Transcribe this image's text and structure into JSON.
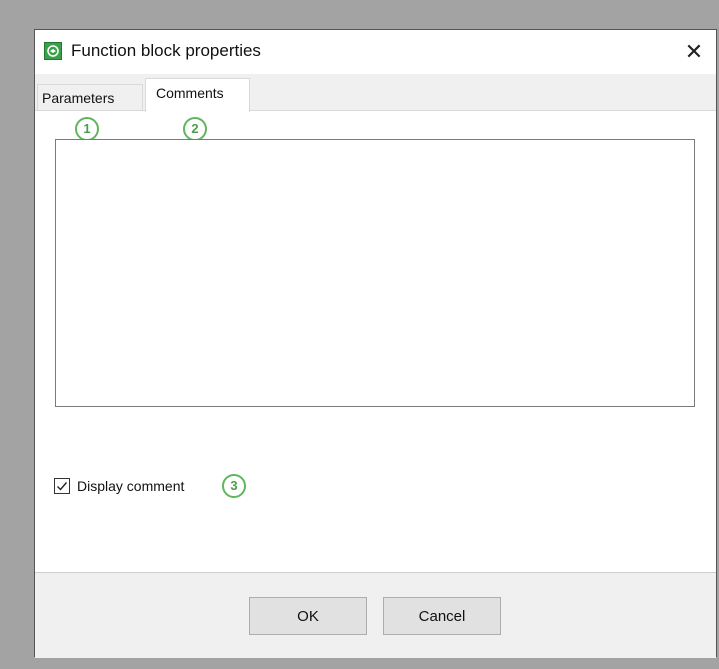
{
  "window": {
    "title": "Function block properties",
    "close_glyph": "✕",
    "app_icon": "function-block-icon"
  },
  "tabs": [
    {
      "label": "Parameters",
      "selected": false
    },
    {
      "label": "Comments",
      "selected": true
    }
  ],
  "callouts": [
    "1",
    "2",
    "3"
  ],
  "comments": {
    "text": "",
    "display_comment_label": "Display comment",
    "display_comment_checked": true
  },
  "buttons": {
    "ok": "OK",
    "cancel": "Cancel"
  },
  "colors": {
    "callout": "#5fb65f",
    "icon": "#3aa14a"
  }
}
